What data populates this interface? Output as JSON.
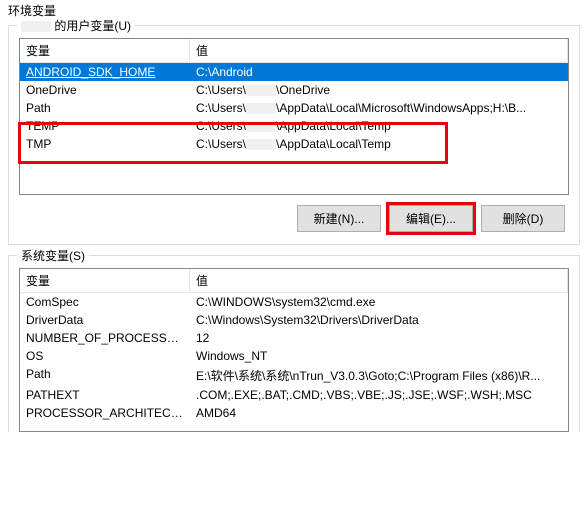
{
  "dialog_title": "环境变量",
  "user_section": {
    "label_suffix": "的用户变量(U)",
    "columns": {
      "name": "变量",
      "value": "值"
    },
    "rows": [
      {
        "name": "ANDROID_SDK_HOME",
        "value": "C:\\Android",
        "selected": true
      },
      {
        "name": "OneDrive",
        "value_prefix": "C:\\Users\\",
        "value_suffix": "\\OneDrive",
        "redacted": true
      },
      {
        "name": "Path",
        "value_prefix": "C:\\Users\\",
        "value_suffix": "\\AppData\\Local\\Microsoft\\WindowsApps;H:\\B...",
        "redacted": true
      },
      {
        "name": "TEMP",
        "value_prefix": "C:\\Users\\",
        "value_suffix": "\\AppData\\Local\\Temp",
        "redacted": true
      },
      {
        "name": "TMP",
        "value_prefix": "C:\\Users\\",
        "value_suffix": "\\AppData\\Local\\Temp",
        "redacted": true
      }
    ],
    "buttons": {
      "new": "新建(N)...",
      "edit": "编辑(E)...",
      "delete": "删除(D)"
    }
  },
  "system_section": {
    "label": "系统变量(S)",
    "columns": {
      "name": "变量",
      "value": "值"
    },
    "rows": [
      {
        "name": "ComSpec",
        "value": "C:\\WINDOWS\\system32\\cmd.exe"
      },
      {
        "name": "DriverData",
        "value": "C:\\Windows\\System32\\Drivers\\DriverData"
      },
      {
        "name": "NUMBER_OF_PROCESSORS",
        "value": "12"
      },
      {
        "name": "OS",
        "value": "Windows_NT"
      },
      {
        "name": "Path",
        "value": "E:\\软件\\系统\\系统\\nTrun_V3.0.3\\Goto;C:\\Program Files (x86)\\R..."
      },
      {
        "name": "PATHEXT",
        "value": ".COM;.EXE;.BAT;.CMD;.VBS;.VBE;.JS;.JSE;.WSF;.WSH;.MSC"
      },
      {
        "name": "PROCESSOR_ARCHITECT...",
        "value": "AMD64"
      }
    ]
  }
}
